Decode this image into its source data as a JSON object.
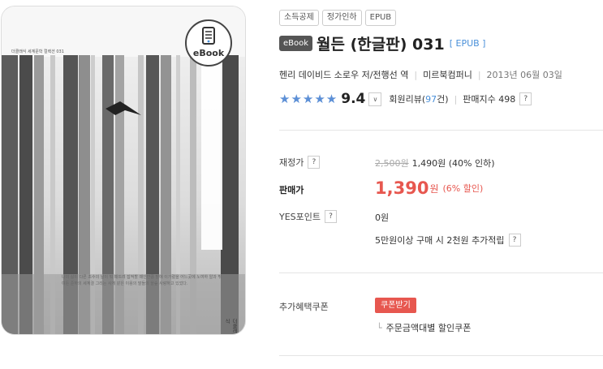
{
  "cover": {
    "series_text": "더클래식 세계문학 컬렉션 031",
    "vertical_text": "헨리 데이비드 소로 지음 · 전행선 옮김",
    "blurb": "나의 삶이 다른 초수의 날이 뭐 때뜨려 잡적할 때인만큼 밭에 이가렸을 어느곳에 노여하 알과 밖여든 준하의 세계결 그리는 사게 같은 이용의 말들의 을숲 사랑하고 있었다.",
    "publisher_mark": "더클래식",
    "ebook_badge_label": "eBook"
  },
  "tags": [
    "소득공제",
    "정가인하",
    "EPUB"
  ],
  "product": {
    "type_chip": "eBook",
    "title": "월든 (한글판) 031",
    "format": "[ EPUB ]",
    "author": "헨리 데이비드 소로우 저/전행선 역",
    "publisher": "미르북컴퍼니",
    "date": "2013년 06월 03일"
  },
  "rating": {
    "stars": 5,
    "score": "9.4",
    "review_prefix": "회원리뷰(",
    "review_count": "97",
    "review_suffix": "건)",
    "sales_index": "판매지수 498"
  },
  "price": {
    "fixed_label": "재정가",
    "original": "2,500원",
    "fixed_value": "1,490원 (40% 인하)",
    "sale_label": "판매가",
    "sale_value": "1,390",
    "sale_unit": "원",
    "sale_discount": "(6% 할인)",
    "points_label": "YES포인트",
    "points_value": "0원",
    "points_note": "5만원이상 구매 시 2천원 추가적립"
  },
  "coupon": {
    "label": "추가혜택쿠폰",
    "button": "쿠폰받기",
    "sub": "주문금액대별 할인쿠폰",
    "sub_arrow": "└"
  },
  "help_icon": "?",
  "dropdown_icon": "∨",
  "colors": {
    "accent_blue": "#4a90d9",
    "sale_red": "#e7574f",
    "star_blue": "#5c8fd6"
  }
}
